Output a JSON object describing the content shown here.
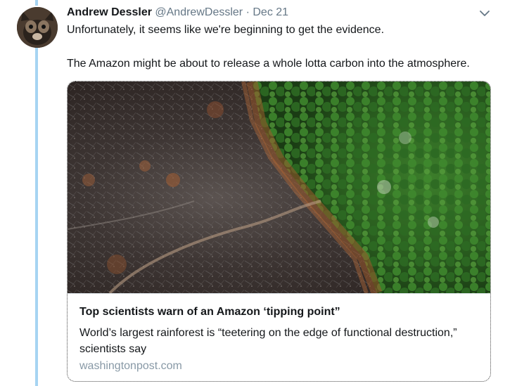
{
  "tweet": {
    "author_name": "Andrew Dessler",
    "handle": "@AndrewDessler",
    "separator": "·",
    "date": "Dec 21",
    "text_lines": [
      "Unfortunately, it seems like we're beginning to get the evidence.",
      "The Amazon might be about to release a whole lotta carbon into the atmosphere."
    ]
  },
  "card": {
    "title": "Top scientists warn of an Amazon ‘tipping point”",
    "description": "World’s largest rainforest is “teetering on the edge of functional destruction,” scientists say",
    "domain": "washingtonpost.com",
    "image_alt": "Aerial view of burned Amazon rainforest next to intact green forest"
  },
  "icons": {
    "more": "chevron-down-icon",
    "avatar": "avatar"
  },
  "colors": {
    "thread_line": "#a6d4f2",
    "secondary_text": "#657786",
    "domain_text": "#8899a6"
  }
}
